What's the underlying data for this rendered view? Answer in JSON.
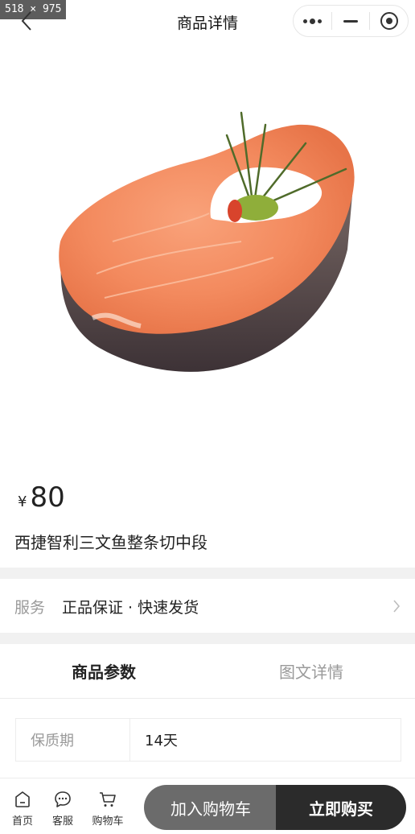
{
  "overlay": {
    "size_text": "518 × 975"
  },
  "navbar": {
    "title": "商品详情"
  },
  "product": {
    "currency": "¥",
    "price": "80",
    "title": "西捷智利三文鱼整条切中段"
  },
  "service": {
    "label": "服务",
    "value": "正品保证 · 快速发货"
  },
  "tabs": [
    {
      "label": "商品参数",
      "active": true
    },
    {
      "label": "图文详情",
      "active": false
    }
  ],
  "params": [
    {
      "key": "保质期",
      "value": "14天"
    }
  ],
  "bottom_bar": {
    "home_label": "首页",
    "service_label": "客服",
    "cart_label": "购物车",
    "add_to_cart": "加入购物车",
    "buy_now": "立即购买"
  },
  "colors": {
    "cart_button": "#6b6b6b",
    "buy_button": "#2b2b2b",
    "section_gap": "#f1f1f1"
  }
}
